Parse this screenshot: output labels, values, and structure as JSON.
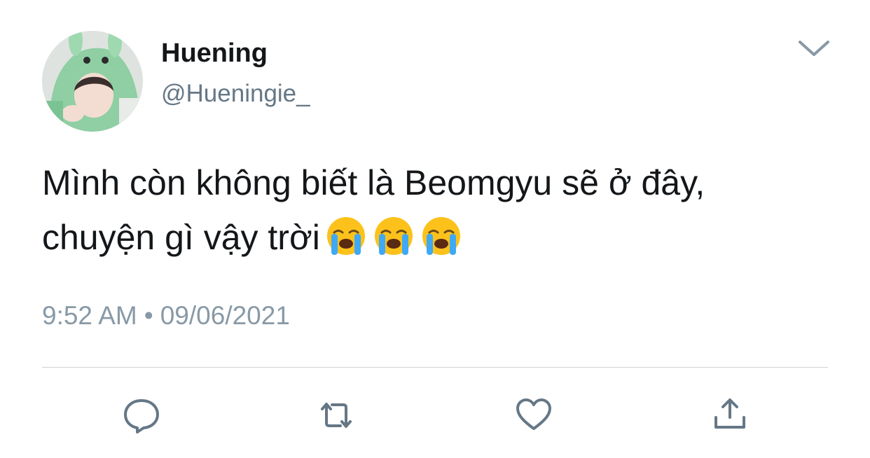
{
  "user": {
    "display_name": "Huening",
    "handle": "@Hueningie_",
    "avatar_icon": "profile-photo"
  },
  "tweet": {
    "text": "Mình còn không biết là Beomgyu sẽ ở đây, chuyện gì vậy trời",
    "emojis": [
      "😭",
      "😭",
      "😭"
    ],
    "time": "9:52 AM",
    "separator": "•",
    "date": "09/06/2021"
  },
  "actions": {
    "reply_icon": "speech-bubble-icon",
    "retweet_icon": "retweet-icon",
    "like_icon": "heart-icon",
    "share_icon": "share-upload-icon"
  },
  "menu": {
    "icon": "chevron-down-icon"
  },
  "colors": {
    "text_primary": "#14171a",
    "text_secondary": "#657786",
    "meta": "#8899a6",
    "icon": "#657786",
    "divider": "#cdd3d8",
    "background": "#ffffff"
  }
}
